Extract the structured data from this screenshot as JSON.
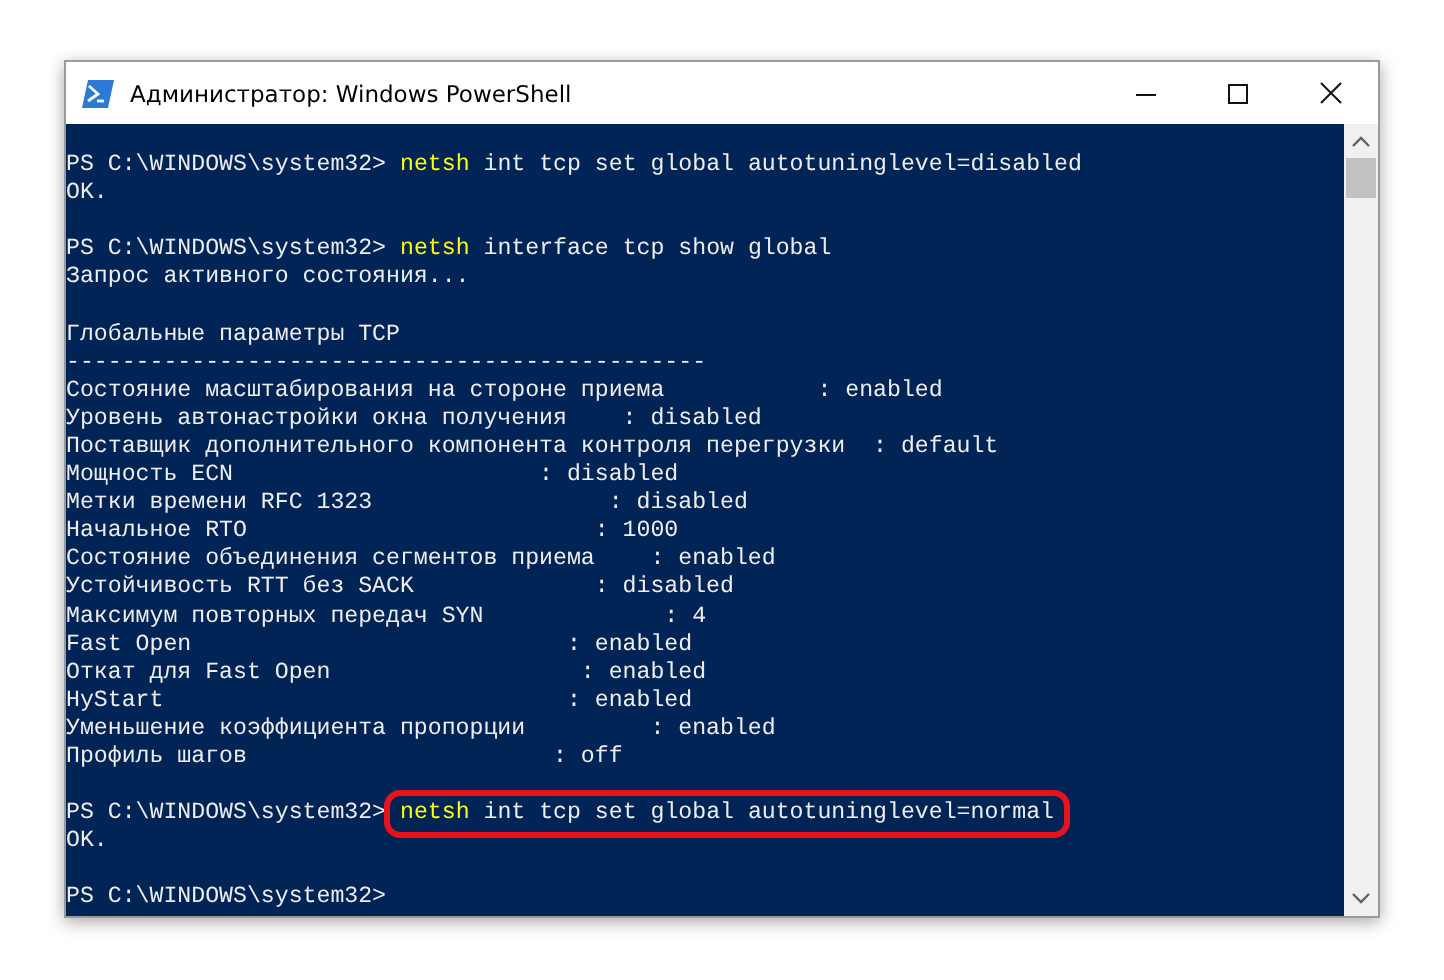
{
  "window": {
    "title": "Администратор: Windows PowerShell"
  },
  "lines": [
    {
      "kind": "command",
      "prompt": "PS C:\\WINDOWS\\system32>",
      "command": "netsh",
      "args": "int tcp set global autotuninglevel=disabled",
      "highlighted": false
    },
    {
      "kind": "output",
      "text": "OK."
    },
    {
      "kind": "blank"
    },
    {
      "kind": "command",
      "prompt": "PS C:\\WINDOWS\\system32>",
      "command": "netsh",
      "args": "interface tcp show global",
      "highlighted": false
    },
    {
      "kind": "output",
      "text": "Запрос активного состояния..."
    },
    {
      "kind": "blank"
    },
    {
      "kind": "output",
      "text": "Глобальные параметры TCP"
    },
    {
      "kind": "output",
      "text": "----------------------------------------------"
    },
    {
      "kind": "output",
      "text": "Состояние масштабирования на стороне приема           : enabled"
    },
    {
      "kind": "output",
      "text": "Уровень автонастройки окна получения    : disabled"
    },
    {
      "kind": "output",
      "text": "Поставщик дополнительного компонента контроля перегрузки  : default"
    },
    {
      "kind": "output",
      "text": "Мощность ECN                      : disabled"
    },
    {
      "kind": "output",
      "text": "Метки времени RFC 1323                 : disabled"
    },
    {
      "kind": "output",
      "text": "Начальное RTO                         : 1000"
    },
    {
      "kind": "output",
      "text": "Состояние объединения сегментов приема    : enabled"
    },
    {
      "kind": "output",
      "text": "Устойчивость RTT без SACK             : disabled"
    },
    {
      "kind": "output",
      "text": "Максимум повторных передач SYN             : 4"
    },
    {
      "kind": "output",
      "text": "Fast Open                           : enabled"
    },
    {
      "kind": "output",
      "text": "Откат для Fast Open                  : enabled"
    },
    {
      "kind": "output",
      "text": "HyStart                             : enabled"
    },
    {
      "kind": "output",
      "text": "Уменьшение коэффициента пропорции         : enabled"
    },
    {
      "kind": "output",
      "text": "Профиль шагов                      : off"
    },
    {
      "kind": "blank"
    },
    {
      "kind": "command",
      "prompt": "PS C:\\WINDOWS\\system32>",
      "command": "netsh",
      "args": "int tcp set global autotuninglevel=normal",
      "highlighted": true
    },
    {
      "kind": "output",
      "text": "OK."
    },
    {
      "kind": "blank"
    },
    {
      "kind": "prompt",
      "prompt": "PS C:\\WINDOWS\\system32>"
    }
  ]
}
